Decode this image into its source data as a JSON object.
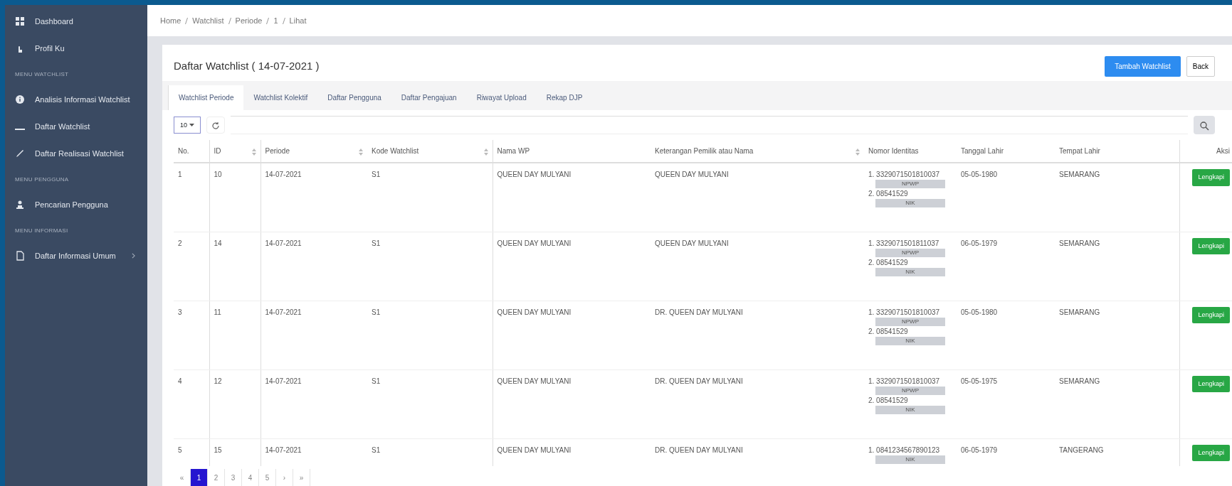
{
  "sidebar": {
    "items": [
      {
        "kind": "link",
        "label": "Dashboard"
      },
      {
        "kind": "link",
        "label": "Profil Ku"
      },
      {
        "kind": "heading",
        "label": "MENU WATCHLIST"
      },
      {
        "kind": "link",
        "label": "Analisis Informasi Watchlist"
      },
      {
        "kind": "link",
        "label": "Daftar Watchlist"
      },
      {
        "kind": "link",
        "label": "Daftar Realisasi Watchlist"
      },
      {
        "kind": "heading",
        "label": "MENU PENGGUNA"
      },
      {
        "kind": "link",
        "label": "Pencarian Pengguna"
      },
      {
        "kind": "heading",
        "label": "MENU INFORMASI"
      },
      {
        "kind": "link",
        "label": "Daftar Informasi Umum",
        "expandable": true
      }
    ]
  },
  "breadcrumb": [
    "Home",
    "Watchlist",
    "Periode",
    "1",
    "Lihat"
  ],
  "card": {
    "title": "Daftar Watchlist ( 14-07-2021 )",
    "buttons": [
      {
        "kind": "primary",
        "label": "Tambah Watchlist"
      },
      {
        "kind": "outline",
        "label": "Back"
      }
    ]
  },
  "tabs": [
    {
      "label": "Watchlist Periode",
      "selected": true
    },
    {
      "label": "Watchlist Kolektif",
      "selected": false
    },
    {
      "label": "Daftar Pengguna",
      "selected": false
    },
    {
      "label": "Daftar Pengajuan",
      "selected": false
    },
    {
      "label": "Riwayat Upload",
      "selected": false
    },
    {
      "label": "Rekap DJP",
      "selected": false
    }
  ],
  "toolbar": {
    "page_size": "10"
  },
  "table": {
    "columns": [
      {
        "label": "No.",
        "sortable": false
      },
      {
        "label": "ID",
        "sortable": true
      },
      {
        "label": "Periode",
        "sortable": true
      },
      {
        "label": "Kode Watchlist",
        "sortable": true
      },
      {
        "label": "Nama WP",
        "sortable": false
      },
      {
        "label": "Keterangan Pemilik atau Nama",
        "sortable": true
      },
      {
        "label": "Nomor Identitas",
        "sortable": false
      },
      {
        "label": "Tanggal Lahir",
        "sortable": false
      },
      {
        "label": "Tempat Lahir",
        "sortable": false
      },
      {
        "label": "Aksi",
        "sortable": false
      }
    ],
    "rows": [
      {
        "no": "1",
        "id": "10",
        "periode": "14-07-2021",
        "kode": "S1",
        "nama": "QUEEN DAY MULYANI",
        "keterangan": "QUEEN DAY MULYANI",
        "identities": [
          {
            "number": "1.",
            "value": "3329071501810037",
            "type": "NPWP"
          },
          {
            "number": "2.",
            "value": "08541529",
            "type": "NIK"
          }
        ],
        "tanggal": "05-05-1980",
        "tempat": "SEMARANG",
        "action": "Lengkapi"
      },
      {
        "no": "2",
        "id": "14",
        "periode": "14-07-2021",
        "kode": "S1",
        "nama": "QUEEN DAY MULYANI",
        "keterangan": "QUEEN DAY MULYANI",
        "identities": [
          {
            "number": "1.",
            "value": "3329071501811037",
            "type": "NPWP"
          },
          {
            "number": "2.",
            "value": "08541529",
            "type": "NIK"
          }
        ],
        "tanggal": "06-05-1979",
        "tempat": "SEMARANG",
        "action": "Lengkapi"
      },
      {
        "no": "3",
        "id": "11",
        "periode": "14-07-2021",
        "kode": "S1",
        "nama": "QUEEN DAY MULYANI",
        "keterangan": "DR. QUEEN DAY MULYANI",
        "identities": [
          {
            "number": "1.",
            "value": "3329071501810037",
            "type": "NPWP"
          },
          {
            "number": "2.",
            "value": "08541529",
            "type": "NIK"
          }
        ],
        "tanggal": "05-05-1980",
        "tempat": "SEMARANG",
        "action": "Lengkapi"
      },
      {
        "no": "4",
        "id": "12",
        "periode": "14-07-2021",
        "kode": "S1",
        "nama": "QUEEN DAY MULYANI",
        "keterangan": "DR. QUEEN DAY MULYANI",
        "identities": [
          {
            "number": "1.",
            "value": "3329071501810037",
            "type": "NPWP"
          },
          {
            "number": "2.",
            "value": "08541529",
            "type": "NIK"
          }
        ],
        "tanggal": "05-05-1975",
        "tempat": "SEMARANG",
        "action": "Lengkapi"
      },
      {
        "no": "5",
        "id": "15",
        "periode": "14-07-2021",
        "kode": "S1",
        "nama": "QUEEN DAY MULYANI",
        "keterangan": "DR. QUEEN DAY MULYANI",
        "identities": [
          {
            "number": "1.",
            "value": "0841234567890123",
            "type": "NIK"
          }
        ],
        "tanggal": "06-05-1979",
        "tempat": "TANGERANG",
        "action": "Lengkapi"
      }
    ]
  },
  "pagination": [
    {
      "label": "«",
      "selected": false
    },
    {
      "label": "1",
      "selected": true
    },
    {
      "label": "2",
      "selected": false
    },
    {
      "label": "3",
      "selected": false
    },
    {
      "label": "4",
      "selected": false
    },
    {
      "label": "5",
      "selected": false
    },
    {
      "label": "›",
      "selected": false
    },
    {
      "label": "»",
      "selected": false
    }
  ]
}
